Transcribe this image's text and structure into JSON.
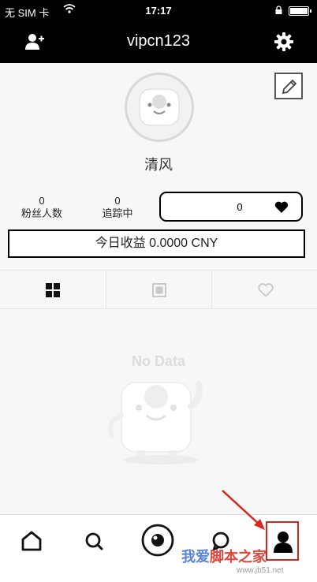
{
  "status_bar": {
    "carrier": "无 SIM 卡",
    "time": "17:17",
    "icons": [
      "wifi-icon",
      "lock-icon",
      "battery-icon"
    ]
  },
  "nav": {
    "title": "vipcn123",
    "left_icon": "add-user-icon",
    "right_icon": "gear-icon"
  },
  "profile": {
    "name": "清风",
    "followers_count": "0",
    "followers_label": "粉丝人数",
    "following_count": "0",
    "following_label": "追踪中",
    "likes_count": "0",
    "earnings": "今日收益 0.0000 CNY"
  },
  "content_tabs": [
    "grid-icon",
    "square-icon",
    "heart-outline-icon"
  ],
  "empty_state": {
    "text": "No Data"
  },
  "tab_bar": [
    "home-icon",
    "search-icon",
    "camera-icon",
    "message-icon",
    "profile-icon"
  ],
  "watermark": {
    "text_blue": "我爱",
    "text_red": "脚本之家",
    "url": "www.jb51.net"
  },
  "colors": {
    "bar_bg": "#000000",
    "accent_red": "#d9261c",
    "watermark_blue": "#3b6fd0"
  }
}
